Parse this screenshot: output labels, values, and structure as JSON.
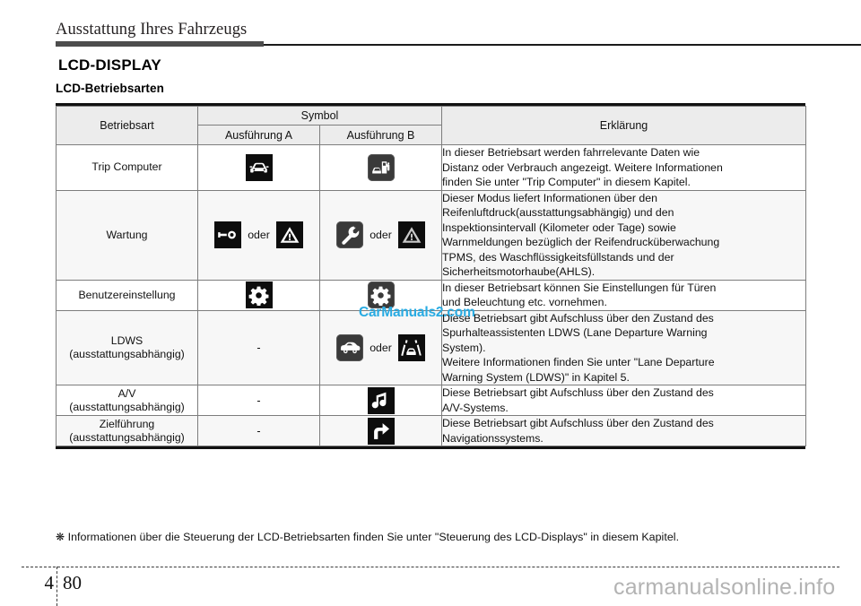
{
  "header": {
    "running_head": "Ausstattung Ihres Fahrzeugs"
  },
  "headings": {
    "title": "LCD-DISPLAY",
    "subtitle": "LCD-Betriebsarten"
  },
  "table": {
    "columns": {
      "mode": "Betriebsart",
      "symbol": "Symbol",
      "variant_a": "Ausführung A",
      "variant_b": "Ausführung B",
      "explanation": "Erklärung"
    },
    "or_label": "oder",
    "dash": "-",
    "rows": [
      {
        "mode": "Trip Computer",
        "mode_sub": "",
        "symbol_a": [
          "car-front-icon"
        ],
        "symbol_b": [
          "fuel-pump-car-icon"
        ],
        "description": [
          "In dieser Betriebsart werden fahrrelevante Daten wie",
          "Distanz oder Verbrauch angezeigt. Weitere Informationen",
          "finden Sie unter \"Trip Computer\" in diesem Kapitel."
        ]
      },
      {
        "mode": "Wartung",
        "mode_sub": "",
        "symbol_a": [
          "wrench-icon",
          "warning-triangle-icon"
        ],
        "symbol_b": [
          "wrench-curved-icon",
          "warning-triangle-gray-icon"
        ],
        "description": [
          "Dieser Modus liefert Informationen über den",
          "Reifenluftdruck(ausstattungsabhängig) und den",
          "Inspektionsintervall (Kilometer oder Tage) sowie",
          "Warnmeldungen bezüglich der Reifendrucküberwachung",
          "TPMS, des Waschflüssigkeitsfüllstands und der",
          "Sicherheitsmotorhaube(AHLS)."
        ]
      },
      {
        "mode": "Benutzereinstellung",
        "mode_sub": "",
        "symbol_a": [
          "gear-icon"
        ],
        "symbol_b": [
          "gear-gray-icon"
        ],
        "description": [
          "In dieser Betriebsart können Sie Einstellungen für Türen",
          "und Beleuchtung etc. vornehmen."
        ]
      },
      {
        "mode": "LDWS",
        "mode_sub": "(ausstattungsabhängig)",
        "symbol_a": [],
        "symbol_b": [
          "car-side-icon",
          "lane-departure-icon"
        ],
        "description": [
          "Diese Betriebsart gibt Aufschluss über den Zustand des",
          "Spurhalteassistenten LDWS (Lane Departure Warning",
          "System).",
          "Weitere Informationen finden Sie unter \"Lane Departure",
          "Warning System (LDWS)\" in Kapitel 5."
        ]
      },
      {
        "mode": "A/V",
        "mode_sub": "(ausstattungsabhängig)",
        "symbol_a": [],
        "symbol_b": [
          "music-note-icon"
        ],
        "description": [
          "Diese Betriebsart gibt Aufschluss über den Zustand des",
          "A/V-Systems."
        ]
      },
      {
        "mode": "Zielführung",
        "mode_sub": "(ausstattungsabhängig)",
        "symbol_a": [],
        "symbol_b": [
          "turn-right-arrow-icon"
        ],
        "description": [
          "Diese Betriebsart gibt Aufschluss über den Zustand des",
          "Navigationssystems."
        ]
      }
    ]
  },
  "footnote": {
    "marker": "❋",
    "text": "Informationen über die Steuerung der LCD-Betriebsarten finden Sie unter \"Steuerung des LCD-Displays\" in diesem Kapitel."
  },
  "page_footer": {
    "chapter": "4",
    "page": "80"
  },
  "watermarks": {
    "table": "CarManuals2.com",
    "bottom": "carmanualsonline.info",
    "table_color": "#29abe2",
    "bottom_color": "#b3b3b3"
  }
}
